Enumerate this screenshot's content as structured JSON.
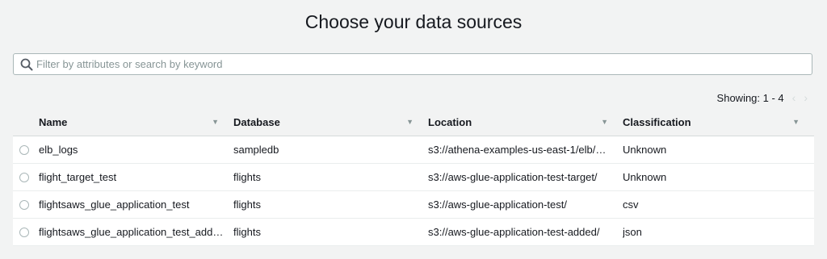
{
  "page": {
    "title": "Choose your data sources"
  },
  "search": {
    "placeholder": "Filter by attributes or search by keyword",
    "value": ""
  },
  "pagination": {
    "showing": "Showing: 1 - 4",
    "prev_icon": "chevron-left-icon",
    "next_icon": "chevron-right-icon"
  },
  "table": {
    "headers": {
      "name": "Name",
      "database": "Database",
      "location": "Location",
      "classification": "Classification"
    },
    "rows": [
      {
        "name": "elb_logs",
        "database": "sampledb",
        "location": "s3://athena-examples-us-east-1/elb/…",
        "classification": "Unknown"
      },
      {
        "name": "flight_target_test",
        "database": "flights",
        "location": "s3://aws-glue-application-test-target/",
        "classification": "Unknown"
      },
      {
        "name": "flightsaws_glue_application_test",
        "database": "flights",
        "location": "s3://aws-glue-application-test/",
        "classification": "csv"
      },
      {
        "name": "flightsaws_glue_application_test_add…",
        "database": "flights",
        "location": "s3://aws-glue-application-test-added/",
        "classification": "json"
      }
    ]
  },
  "colors": {
    "background": "#f2f3f3",
    "border": "#d5dbdb",
    "text": "#16191f",
    "muted": "#879596"
  }
}
